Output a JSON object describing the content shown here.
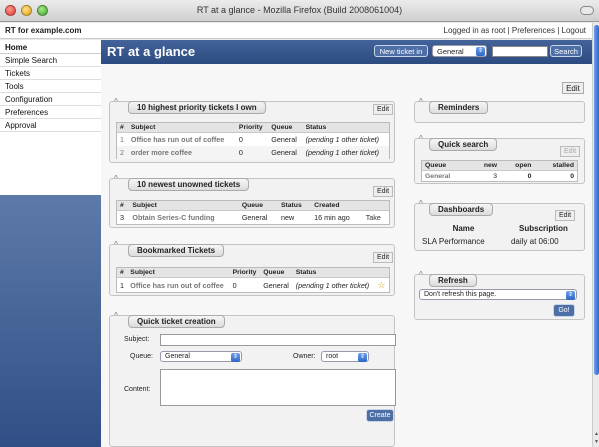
{
  "window": {
    "title": "RT at a glance - Mozilla Firefox (Build 2008061004)"
  },
  "topbar": {
    "brand": "RT for example.com",
    "logged_in": "Logged in as root",
    "separator": " | ",
    "preferences": "Preferences",
    "logout": "Logout"
  },
  "nav": {
    "items": [
      "Home",
      "Simple Search",
      "Tickets",
      "Tools",
      "Configuration",
      "Preferences",
      "Approval"
    ]
  },
  "header": {
    "title": "RT at a glance",
    "new_ticket_label": "New ticket in",
    "queue_value": "General",
    "search_value": "",
    "search_label": "Search"
  },
  "page_edit_label": "Edit",
  "priority_tickets": {
    "title": "10 highest priority tickets I own",
    "edit": "Edit",
    "columns": [
      "#",
      "Subject",
      "Priority",
      "Queue",
      "Status"
    ],
    "rows": [
      {
        "id": "1",
        "subject": "Office has run out of coffee",
        "priority": "0",
        "queue": "General",
        "status": "(pending 1 other ticket)"
      },
      {
        "id": "2",
        "subject": "order more coffee",
        "priority": "0",
        "queue": "General",
        "status": "(pending 1 other ticket)"
      }
    ]
  },
  "unowned_tickets": {
    "title": "10 newest unowned tickets",
    "edit": "Edit",
    "columns": [
      "#",
      "Subject",
      "Queue",
      "Status",
      "Created",
      ""
    ],
    "rows": [
      {
        "id": "3",
        "subject": "Obtain Series-C funding",
        "queue": "General",
        "status": "new",
        "created": "16 min ago",
        "action": "Take"
      }
    ]
  },
  "bookmarked": {
    "title": "Bookmarked Tickets",
    "edit": "Edit",
    "columns": [
      "#",
      "Subject",
      "Priority",
      "Queue",
      "Status",
      ""
    ],
    "rows": [
      {
        "id": "1",
        "subject": "Office has run out of coffee",
        "priority": "0",
        "queue": "General",
        "status": "(pending 1 other ticket)",
        "bookmark": "☆"
      }
    ]
  },
  "quick_create": {
    "title": "Quick ticket creation",
    "subject_label": "Subject:",
    "subject_value": "",
    "queue_label": "Queue:",
    "queue_value": "General",
    "owner_label": "Owner:",
    "owner_value": "root",
    "content_label": "Content:",
    "content_value": "",
    "create_label": "Create"
  },
  "reminders": {
    "title": "Reminders"
  },
  "quick_search": {
    "title": "Quick search",
    "edit": "Edit",
    "columns": [
      "Queue",
      "new",
      "open",
      "stalled"
    ],
    "rows": [
      {
        "queue": "General",
        "new": "3",
        "open": "0",
        "stalled": "0"
      }
    ]
  },
  "dashboards": {
    "title": "Dashboards",
    "edit": "Edit",
    "columns": [
      "Name",
      "Subscription"
    ],
    "rows": [
      {
        "name": "SLA Performance",
        "subscription": "daily at 06:00"
      }
    ]
  },
  "refresh": {
    "title": "Refresh",
    "select_value": "Don't refresh this page.",
    "go_label": "Go!"
  },
  "icons": {
    "toggle": "collapse-caret",
    "select_arrow": "updown-arrows",
    "bookmark": "star-outline"
  },
  "colors": {
    "header_blue": "#34558c",
    "button_blue": "#4e6fa6",
    "select_blue": "#2d66c8"
  }
}
